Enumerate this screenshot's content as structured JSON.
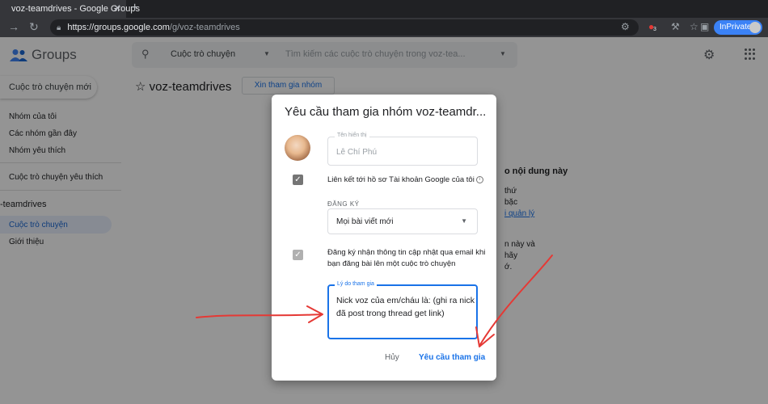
{
  "browser": {
    "tab_title": "voz-teamdrives - Google Groups",
    "tab_close": "✕",
    "new_tab": "+",
    "url_host": "https://groups.google.com",
    "url_path": "/g/voz-teamdrives",
    "notification_count": "3",
    "inprivate_label": "InPrivate"
  },
  "app": {
    "name": "Groups",
    "search_scope": "Cuộc trò chuyện",
    "search_placeholder": "Tìm kiếm các cuộc trò chuyện trong voz-tea..."
  },
  "sidebar": {
    "new_conversation": "Cuộc trò chuyện mới",
    "items": [
      {
        "label": "Nhóm của tôi"
      },
      {
        "label": "Các nhóm gần đây"
      },
      {
        "label": "Nhóm yêu thích"
      },
      {
        "label": "Cuộc trò chuyện yêu thích"
      }
    ],
    "group_heading": "-teamdrives",
    "group_items": [
      {
        "label": "Cuộc trò chuyện",
        "active": true
      },
      {
        "label": "Giới thiệu"
      }
    ]
  },
  "main": {
    "star": "☆",
    "group_name": "voz-teamdrives",
    "join_button": "Xin tham gia nhóm",
    "bg_heading": "o nội dung này",
    "bg_line1": "thứ",
    "bg_line2": "bặc",
    "bg_link": "i quản lý",
    "bg_line4": "n này và",
    "bg_line5": "hãy",
    "bg_line6": "ớ."
  },
  "dialog": {
    "title": "Yêu cầu tham gia nhóm voz-teamdr...",
    "display_name_label": "Tên hiển thị",
    "display_name_value": "Lê Chí Phú",
    "link_profile_label": "Liên kết tới hồ sơ Tài khoản Google của tôi",
    "info_glyph": "i",
    "subscription_heading": "ĐĂNG KÝ",
    "subscription_value": "Mọi bài viết mới",
    "email_updates_label": "Đăng ký nhận thông tin cập nhật qua email khi bạn đăng bài lên một cuộc trò chuyện",
    "reason_label": "Lý do tham gia",
    "reason_value": "Nick voz của em/cháu là: (ghi ra nick đã post trong thread get link)",
    "cancel_button": "Hủy",
    "submit_button": "Yêu cầu tham gia",
    "checkmark": "✓"
  },
  "colors": {
    "accent": "#1a73e8",
    "annotation_red": "#e53935",
    "scrim": "rgba(0,0,0,0.42)"
  }
}
